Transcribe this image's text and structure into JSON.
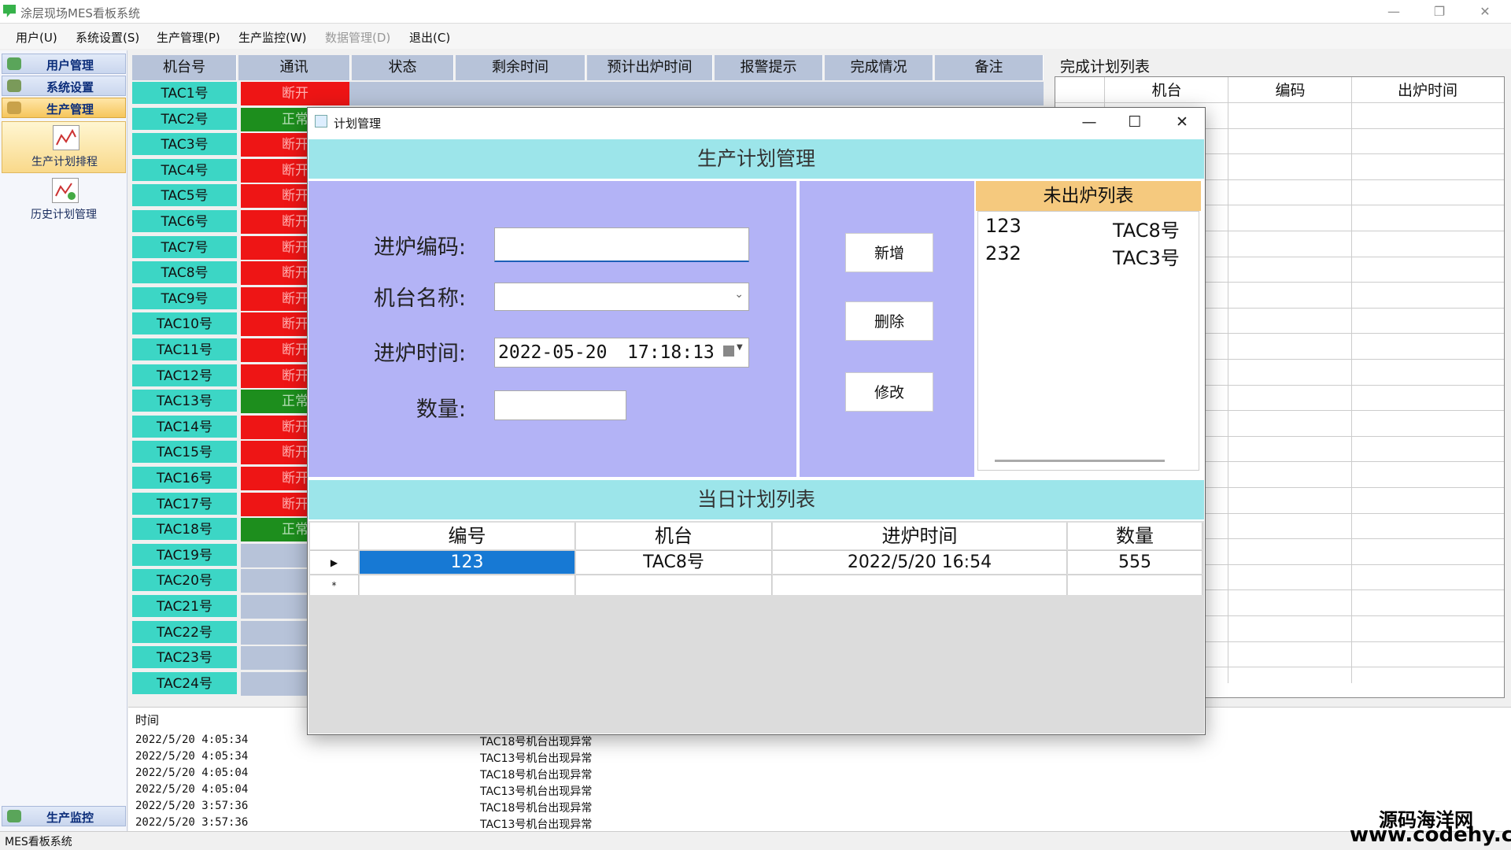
{
  "app": {
    "title": "涂层现场MES看板系统",
    "status_text": "MES看板系统"
  },
  "menu": [
    "用户(U)",
    "系统设置(S)",
    "生产管理(P)",
    "生产监控(W)",
    "数据管理(D)",
    "退出(C)"
  ],
  "nav": {
    "sections": [
      "用户管理",
      "系统设置",
      "生产管理"
    ],
    "tiles": [
      "生产计划排程",
      "历史计划管理"
    ],
    "bottom": "生产监控"
  },
  "grid": {
    "headers": [
      "机台号",
      "通讯",
      "状态",
      "剩余时间",
      "预计出炉时间",
      "报警提示",
      "完成情况",
      "备注"
    ],
    "rows": [
      {
        "name": "TAC1号",
        "comm": "断开"
      },
      {
        "name": "TAC2号",
        "comm": "正常"
      },
      {
        "name": "TAC3号",
        "comm": "断开"
      },
      {
        "name": "TAC4号",
        "comm": "断开"
      },
      {
        "name": "TAC5号",
        "comm": "断开"
      },
      {
        "name": "TAC6号",
        "comm": "断开"
      },
      {
        "name": "TAC7号",
        "comm": "断开"
      },
      {
        "name": "TAC8号",
        "comm": "断开"
      },
      {
        "name": "TAC9号",
        "comm": "断开"
      },
      {
        "name": "TAC10号",
        "comm": "断开"
      },
      {
        "name": "TAC11号",
        "comm": "断开"
      },
      {
        "name": "TAC12号",
        "comm": "断开"
      },
      {
        "name": "TAC13号",
        "comm": "正常"
      },
      {
        "name": "TAC14号",
        "comm": "断开"
      },
      {
        "name": "TAC15号",
        "comm": "断开"
      },
      {
        "name": "TAC16号",
        "comm": "断开"
      },
      {
        "name": "TAC17号",
        "comm": "断开"
      },
      {
        "name": "TAC18号",
        "comm": "正常"
      },
      {
        "name": "TAC19号",
        "comm": ""
      },
      {
        "name": "TAC20号",
        "comm": ""
      },
      {
        "name": "TAC21号",
        "comm": ""
      },
      {
        "name": "TAC22号",
        "comm": ""
      },
      {
        "name": "TAC23号",
        "comm": ""
      },
      {
        "name": "TAC24号",
        "comm": ""
      }
    ]
  },
  "log": {
    "header": "时间",
    "entries": [
      {
        "time": "2022/5/20 4:05:34",
        "msg": "TAC18号机台出现异常"
      },
      {
        "time": "2022/5/20 4:05:34",
        "msg": "TAC13号机台出现异常"
      },
      {
        "time": "2022/5/20 4:05:04",
        "msg": "TAC18号机台出现异常"
      },
      {
        "time": "2022/5/20 4:05:04",
        "msg": "TAC13号机台出现异常"
      },
      {
        "time": "2022/5/20 3:57:36",
        "msg": "TAC18号机台出现异常"
      },
      {
        "time": "2022/5/20 3:57:36",
        "msg": "TAC13号机台出现异常"
      }
    ]
  },
  "done": {
    "title": "完成计划列表",
    "headers": [
      "机台",
      "编码",
      "出炉时间"
    ]
  },
  "dialog": {
    "title": "计划管理",
    "banner": "生产计划管理",
    "labels": {
      "code": "进炉编码:",
      "machine": "机台名称:",
      "time": "进炉时间:",
      "qty": "数量:"
    },
    "values": {
      "code": "",
      "machine": "",
      "date": "2022-05-20",
      "clock": "17:18:13",
      "qty": ""
    },
    "buttons": {
      "add": "新增",
      "delete": "删除",
      "edit": "修改"
    },
    "pending": {
      "title": "未出炉列表",
      "items": [
        {
          "code": "123",
          "machine": "TAC8号"
        },
        {
          "code": "232",
          "machine": "TAC3号"
        }
      ]
    },
    "today": {
      "title": "当日计划列表",
      "headers": [
        "编号",
        "机台",
        "进炉时间",
        "数量"
      ],
      "rows": [
        {
          "code": "123",
          "machine": "TAC8号",
          "time": "2022/5/20 16:54",
          "qty": "555"
        }
      ]
    }
  },
  "watermark": {
    "line1": "源码海洋网",
    "line2": "www.codehy.com"
  }
}
